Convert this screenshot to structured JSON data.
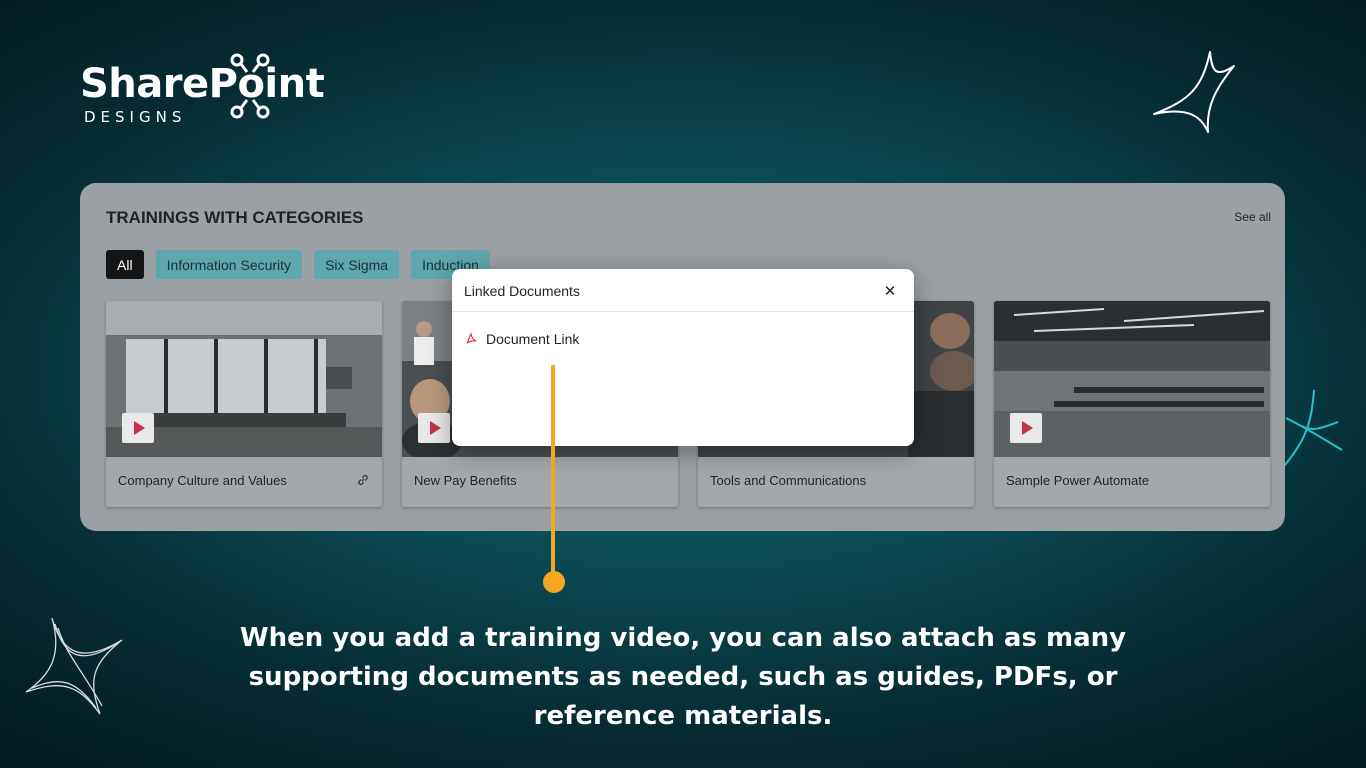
{
  "brand": {
    "name": "SharePoint",
    "tagline": "DESIGNS"
  },
  "panel": {
    "title": "TRAININGS WITH CATEGORIES",
    "see_all": "See all"
  },
  "categories": [
    {
      "label": "All",
      "active": true
    },
    {
      "label": "Information Security",
      "active": false
    },
    {
      "label": "Six Sigma",
      "active": false
    },
    {
      "label": "Induction",
      "active": false
    }
  ],
  "cards": [
    {
      "title": "Company Culture and Values",
      "icon": "play-icon",
      "has_link": true
    },
    {
      "title": "New Pay Benefits",
      "icon": "play-icon",
      "has_link": false
    },
    {
      "title": "Tools and Communications",
      "icon": "play-icon",
      "has_link": false
    },
    {
      "title": "Sample Power Automate",
      "icon": "play-icon",
      "has_link": false
    }
  ],
  "dialog": {
    "title": "Linked Documents",
    "close_symbol": "✕",
    "items": [
      {
        "label": "Document Link",
        "icon": "pdf-icon"
      }
    ]
  },
  "caption": "When you add a training video, you can also attach as many supporting documents as needed, such as guides, PDFs, or reference materials.",
  "colors": {
    "accent": "#f5a623",
    "chip": "#5ea7ac",
    "chip_active": "#151515",
    "play": "#c4314b"
  }
}
